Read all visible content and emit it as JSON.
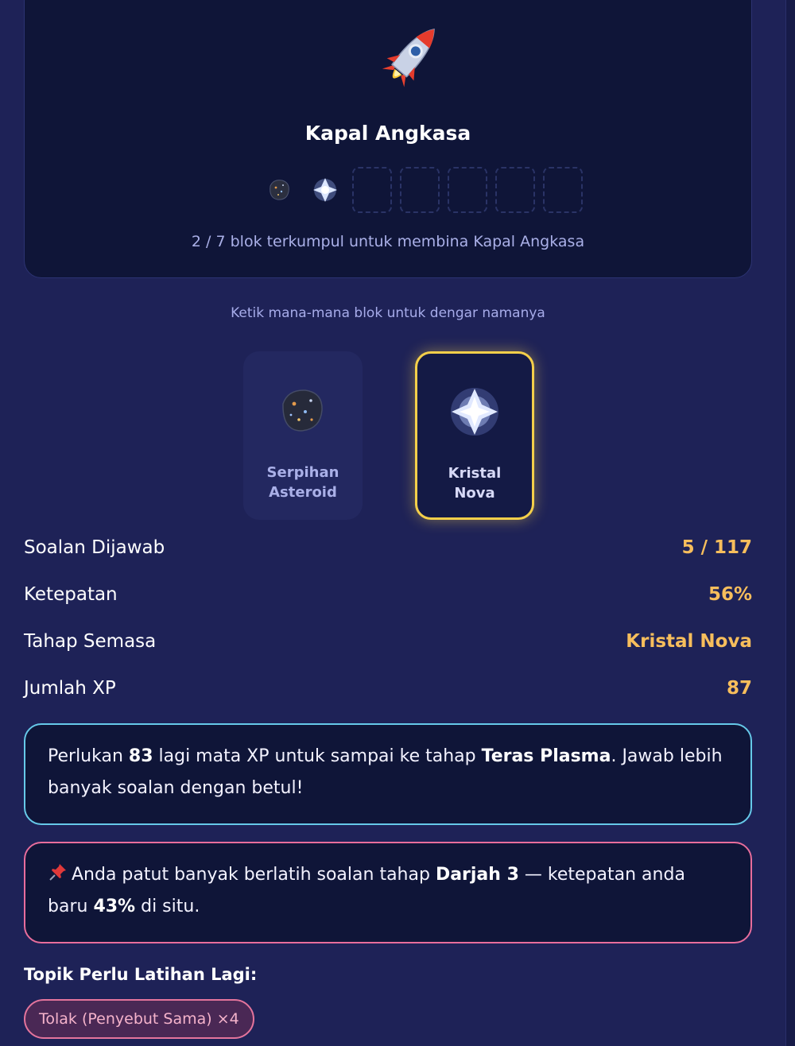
{
  "ship": {
    "title": "Kapal Angkasa",
    "icon": "rocket-icon",
    "progress_text": "2 / 7 blok terkumpul untuk membina Kapal Angkasa",
    "collected": 2,
    "total": 7
  },
  "hint": "Ketik mana-mana blok untuk dengar namanya",
  "stages": [
    {
      "label": "Serpihan Asteroid",
      "icon": "asteroid-icon",
      "selected": false
    },
    {
      "label": "Kristal Nova",
      "icon": "nova-crystal-icon",
      "selected": true
    }
  ],
  "stats": {
    "answered_label": "Soalan Dijawab",
    "answered_value": "5 / 117",
    "accuracy_label": "Ketepatan",
    "accuracy_value": "56%",
    "stage_label": "Tahap Semasa",
    "stage_value": "Kristal Nova",
    "xp_label": "Jumlah XP",
    "xp_value": "87"
  },
  "xp_notice": {
    "prefix": "Perlukan ",
    "xp_needed": "83",
    "middle": " lagi mata XP untuk sampai ke tahap ",
    "next_stage": "Teras Plasma",
    "suffix": ". Jawab lebih banyak soalan dengan betul!"
  },
  "practice_notice": {
    "icon": "pushpin-icon",
    "prefix": "Anda patut banyak berlatih soalan tahap ",
    "level": "Darjah 3",
    "middle": " — ketepatan anda baru ",
    "accuracy": "43%",
    "suffix": " di situ."
  },
  "topics": {
    "heading": "Topik Perlu Latihan Lagi:",
    "items": [
      "Tolak (Penyebut Sama) ×4"
    ]
  },
  "colors": {
    "background": "#1e2257",
    "card": "#0f1538",
    "accent_gold": "#f7be5c",
    "selected_border": "#f4cf4a",
    "info_border": "#66c9e9",
    "warn_border": "#e86d9c"
  }
}
